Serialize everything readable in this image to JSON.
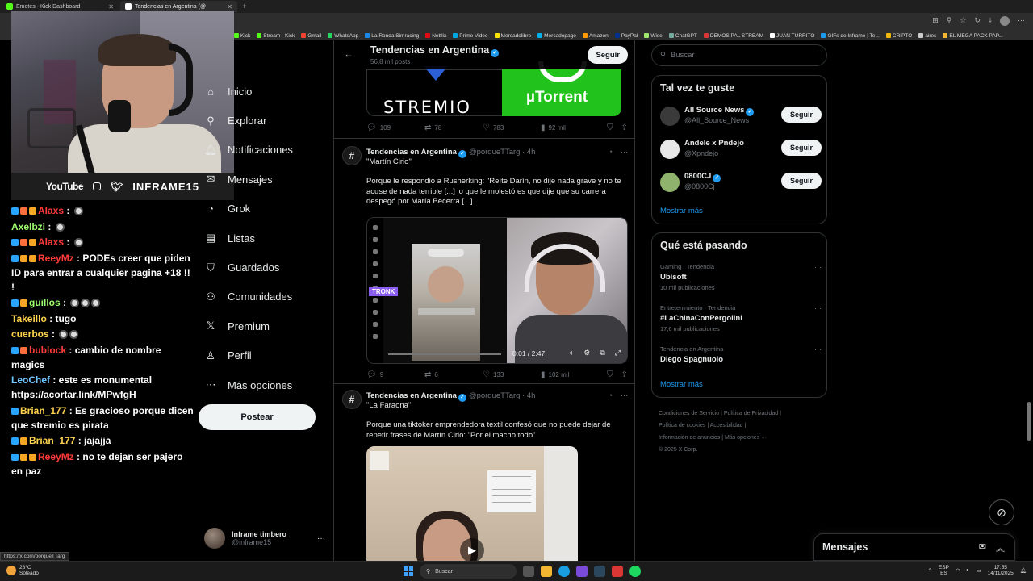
{
  "browser": {
    "tabs": [
      {
        "title": "Emotes - Kick Dashboard",
        "active": false,
        "fav": "#53fc18"
      },
      {
        "title": "Tendencias en Argentina (@",
        "active": true,
        "fav": "#ffffff"
      }
    ],
    "bookmarks": [
      "Kick",
      "Stream - Kick",
      "Gmail",
      "WhatsApp",
      "La Ronda Simracing",
      "Netflix",
      "Prime Video",
      "Mercadolibre",
      "Mercadopago",
      "Amazon",
      "PayPal",
      "Wise",
      "ChatGPT",
      "DEMOS PAL STREAM",
      "JUAN TURRITO",
      "GIFs de Inframe | Te...",
      "CRIPTO",
      "aires",
      "EL MEGA PACK PAP..."
    ],
    "status_url": "https://x.com/porqueTTarg"
  },
  "overlay": {
    "youtube": "YouTube",
    "brand": "INFRAME15"
  },
  "chat": [
    {
      "user": "Alaxs",
      "color": "#ff3b3b",
      "text": ": ",
      "emotes": 1,
      "badges": [
        "#2aa5ff",
        "#ff6f3b",
        "#f5a623"
      ]
    },
    {
      "user": "Axelbzi",
      "color": "#9eff6e",
      "text": ": ",
      "emotes": 1,
      "badges": []
    },
    {
      "user": "Alaxs",
      "color": "#ff3b3b",
      "text": ": ",
      "emotes": 1,
      "badges": [
        "#2aa5ff",
        "#ff6f3b",
        "#f5a623"
      ]
    },
    {
      "user": "ReeyMz",
      "color": "#ff3b3b",
      "text": ": PODEs creer que piden ID para entrar a cualquier pagina +18 !! !",
      "emotes": 0,
      "badges": [
        "#2aa5ff",
        "#f5a623",
        "#f5a623"
      ]
    },
    {
      "user": "guillos",
      "color": "#9eff6e",
      "text": ": ",
      "emotes": 3,
      "badges": [
        "#2aa5ff",
        "#f5a623"
      ]
    },
    {
      "user": "Takeillo",
      "color": "#ffd34e",
      "text": ": tugo",
      "emotes": 0,
      "badges": []
    },
    {
      "user": "cuerbos",
      "color": "#ffd34e",
      "text": ": ",
      "emotes": 2,
      "badges": []
    },
    {
      "user": "bublock",
      "color": "#ff3b3b",
      "text": ": cambio de nombre magics",
      "emotes": 0,
      "badges": [
        "#2aa5ff",
        "#ff6f3b"
      ]
    },
    {
      "user": "LeoChef",
      "color": "#6ec6ff",
      "text": ": este es monumental https://acortar.link/MPwfgH",
      "emotes": 0,
      "badges": []
    },
    {
      "user": "Brian_177",
      "color": "#ffd34e",
      "text": ": Es gracioso porque dicen que stremio es pirata",
      "emotes": 0,
      "badges": [
        "#2aa5ff"
      ]
    },
    {
      "user": "Brian_177",
      "color": "#ffd34e",
      "text": ": jajajja",
      "emotes": 0,
      "badges": [
        "#2aa5ff",
        "#f5a623"
      ]
    },
    {
      "user": "ReeyMz",
      "color": "#ff3b3b",
      "text": ": no te dejan ser pajero en paz",
      "emotes": 0,
      "badges": [
        "#2aa5ff",
        "#f5a623",
        "#f5a623"
      ]
    }
  ],
  "nav": {
    "items": [
      {
        "label": "Inicio",
        "icon": "home-icon",
        "glyph": "⌂"
      },
      {
        "label": "Explorar",
        "icon": "search-icon",
        "glyph": "⚲"
      },
      {
        "label": "Notificaciones",
        "icon": "bell-icon",
        "glyph": "🔔︎"
      },
      {
        "label": "Mensajes",
        "icon": "mail-icon",
        "glyph": "✉"
      },
      {
        "label": "Grok",
        "icon": "grok-icon",
        "glyph": "◔"
      },
      {
        "label": "Listas",
        "icon": "list-icon",
        "glyph": "▤"
      },
      {
        "label": "Guardados",
        "icon": "bookmark-icon",
        "glyph": "⛉"
      },
      {
        "label": "Comunidades",
        "icon": "communities-icon",
        "glyph": "⚇"
      },
      {
        "label": "Premium",
        "icon": "x-icon",
        "glyph": "𝕏"
      },
      {
        "label": "Perfil",
        "icon": "profile-icon",
        "glyph": "♙"
      },
      {
        "label": "Más opciones",
        "icon": "more-icon",
        "glyph": "⋯"
      }
    ],
    "post_label": "Postear",
    "account": {
      "name": "Inframe timbero",
      "handle": "@inframe15"
    }
  },
  "timeline": {
    "title": "Tendencias en Argentina",
    "subtitle": "56,8 mil posts",
    "follow_label": "Seguir",
    "tile_stremio": "STREMIO",
    "tile_utorrent": "µTorrent",
    "first_actions": {
      "replies": "109",
      "reposts": "78",
      "likes": "783",
      "views": "92 mil"
    },
    "tweets": [
      {
        "name": "Tendencias en Argentina",
        "handle": "@porqueTTarg · 4h",
        "title": "\"Martín Cirio\"",
        "body": "Porque le respondió a Rusherking: \"Reíte Darín, no dije nada grave y no te acuse de nada terrible [...] lo que le molestó es que dije que su carrera despegó por María Becerra [...].",
        "video_time": "0:01 / 2:47",
        "tronk": "TRONK",
        "replies": "9",
        "reposts": "6",
        "likes": "133",
        "views": "102 mil"
      },
      {
        "name": "Tendencias en Argentina",
        "handle": "@porqueTTarg · 4h",
        "title": "\"La Faraona\"",
        "body": "Porque una tiktoker emprendedora textil confesó que no puede dejar de repetir frases de Martín Cirio: \"Por el macho todo\""
      }
    ]
  },
  "sidebar": {
    "search_placeholder": "Buscar",
    "wtf_title": "Tal vez te guste",
    "wtf": [
      {
        "name": "All Source News",
        "handle": "@All_Source_News",
        "color": "#3a3a3a"
      },
      {
        "name": "Andele x Pndejo",
        "handle": "@Xpndejo",
        "color": "#e8e8e8"
      },
      {
        "name": "0800CJ",
        "handle": "@0800Cj",
        "color": "#8fb36c"
      }
    ],
    "follow_label": "Seguir",
    "show_more": "Mostrar más",
    "trends_title": "Qué está pasando",
    "trends": [
      {
        "category": "Gaming · Tendencia",
        "topic": "Ubisoft",
        "count": "10 mil publicaciones"
      },
      {
        "category": "Entretenimiento · Tendencia",
        "topic": "#LaChinaConPergolini",
        "count": "17,6 mil publicaciones"
      },
      {
        "category": "Tendencia en Argentina",
        "topic": "Diego Spagnuolo",
        "count": ""
      }
    ],
    "footer": [
      "Condiciones de Servicio",
      "Política de Privacidad",
      "Política de cookies",
      "Accesibilidad",
      "Información de anuncios",
      "Más opciones ···",
      "© 2025 X Corp."
    ]
  },
  "messages_drawer": "Mensajes",
  "taskbar": {
    "temp": "28°C",
    "weather": "Soleado",
    "search": "Buscar",
    "lang": "ESP",
    "lang2": "ES",
    "time": "17:55",
    "date": "14/11/2025"
  }
}
